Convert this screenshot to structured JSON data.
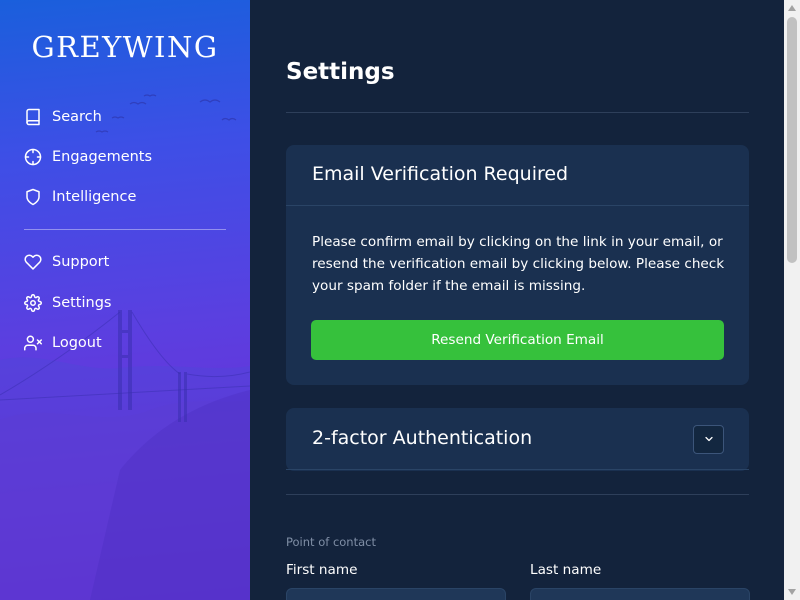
{
  "brand": {
    "logo_text": "GREYWING"
  },
  "sidebar": {
    "items": [
      {
        "label": "Search",
        "icon": "book-icon"
      },
      {
        "label": "Engagements",
        "icon": "crosshair-icon"
      },
      {
        "label": "Intelligence",
        "icon": "shield-icon"
      },
      {
        "label": "Support",
        "icon": "heart-icon"
      },
      {
        "label": "Settings",
        "icon": "gear-icon"
      },
      {
        "label": "Logout",
        "icon": "user-x-icon"
      }
    ]
  },
  "main": {
    "title": "Settings",
    "email_verification": {
      "title": "Email Verification Required",
      "body": "Please confirm email by clicking on the link in your email, or resend the verification email by clicking below. Please check your spam folder if the email is missing.",
      "button_label": "Resend Verification Email"
    },
    "two_factor": {
      "title": "2-factor Authentication",
      "toggle_icon": "chevron-down-icon"
    },
    "point_of_contact": {
      "section_label": "Point of contact",
      "first_name_label": "First name",
      "last_name_label": "Last name",
      "first_name_value": "",
      "last_name_value": ""
    }
  },
  "colors": {
    "accent_green": "#36c13c",
    "sidebar_gradient_top": "#1a5fdc",
    "sidebar_gradient_bottom": "#6c20cc",
    "main_background": "#13233c",
    "card_background": "#1a3050"
  }
}
